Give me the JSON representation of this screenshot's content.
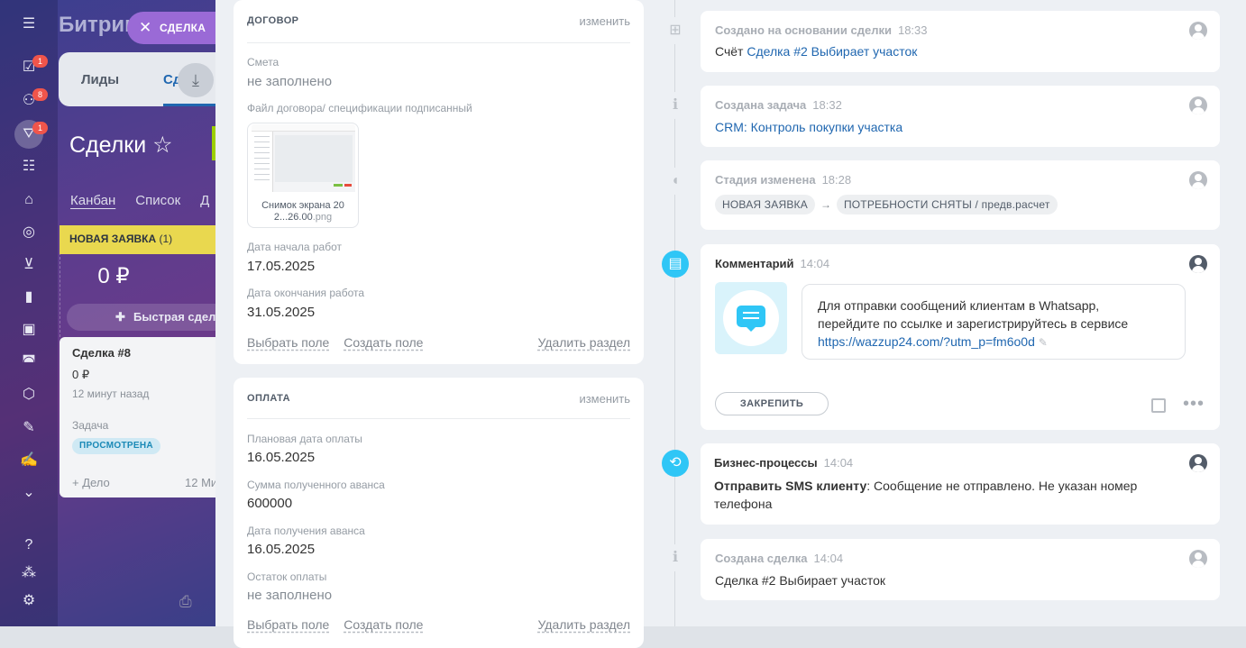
{
  "brand": "Битрик",
  "deal_pill": {
    "label": "СДЕЛКА"
  },
  "left_bar": {
    "badges": [
      "1",
      "8",
      "1"
    ]
  },
  "crm_tabs": {
    "leads": "Лиды",
    "deals": "Сд"
  },
  "page_title": "Сделки",
  "view_tabs": [
    "Канбан",
    "Список",
    "Д"
  ],
  "column": {
    "name": "НОВАЯ ЗАЯВКА",
    "count": "(1)",
    "sum": "0 ₽",
    "quick_add": "Быстрая сделк"
  },
  "deal_card": {
    "title": "Сделка #8",
    "price": "0 ₽",
    "ago": "12 минут назад",
    "task_label": "Задача",
    "task_status": "ПРОСМОТРЕНА",
    "add_label": "+ Дело",
    "time_label": "12 Ми"
  },
  "contract": {
    "title": "ДОГОВОР",
    "edit": "изменить",
    "fields": [
      {
        "label": "Смета",
        "value": "не заполнено"
      },
      {
        "label": "Файл договора/ спецификации подписанный",
        "value": ""
      },
      {
        "label": "Дата начала работ",
        "value": "17.05.2025"
      },
      {
        "label": "Дата окончания работа",
        "value": "31.05.2025"
      }
    ],
    "file": {
      "name": "Снимок экрана 20",
      "name2": "2...26.00",
      "ext": ".png"
    },
    "links": {
      "select": "Выбрать поле",
      "create": "Создать поле",
      "delete": "Удалить раздел"
    }
  },
  "payment": {
    "title": "ОПЛАТА",
    "edit": "изменить",
    "fields": [
      {
        "label": "Плановая дата оплаты",
        "value": "16.05.2025"
      },
      {
        "label": "Сумма полученного аванса",
        "value": "600000"
      },
      {
        "label": "Дата получения аванса",
        "value": "16.05.2025"
      },
      {
        "label": "Остаток оплаты",
        "value": "не заполнено"
      }
    ],
    "links": {
      "select": "Выбрать поле",
      "create": "Создать поле",
      "delete": "Удалить раздел"
    }
  },
  "timeline": [
    {
      "title": "Создано на основании сделки",
      "time": "18:33",
      "prefix": "Счёт",
      "link": "Сделка #2 Выбирает участок"
    },
    {
      "title": "Создана задача",
      "time": "18:32",
      "link": "CRM: Контроль покупки участка"
    },
    {
      "title": "Стадия изменена",
      "time": "18:28",
      "from": "НОВАЯ ЗАЯВКА",
      "to": "ПОТРЕБНОСТИ СНЯТЫ / предв.расчет"
    },
    {
      "title": "Комментарий",
      "time": "14:04",
      "line1": "Для отправки сообщений клиентам в Whatsapp,",
      "line2": "перейдите по ссылке и зарегистрируйтесь в сервисе",
      "url": "https://wazzup24.com/?utm_p=fm6o0d",
      "pin": "ЗАКРЕПИТЬ"
    },
    {
      "title": "Бизнес-процессы",
      "time": "14:04",
      "bold": "Отправить SMS клиенту",
      "text1": ": Сообщение не отправлено. Не указан номер",
      "text2": "телефона"
    },
    {
      "title": "Создана сделка",
      "time": "14:04",
      "text": "Сделка #2 Выбирает участок"
    }
  ],
  "colors": {
    "accent": "#2fc6f6",
    "link": "#2067b0",
    "stage_yellow": "#e9d84f",
    "pill": "#9a6ad6"
  }
}
